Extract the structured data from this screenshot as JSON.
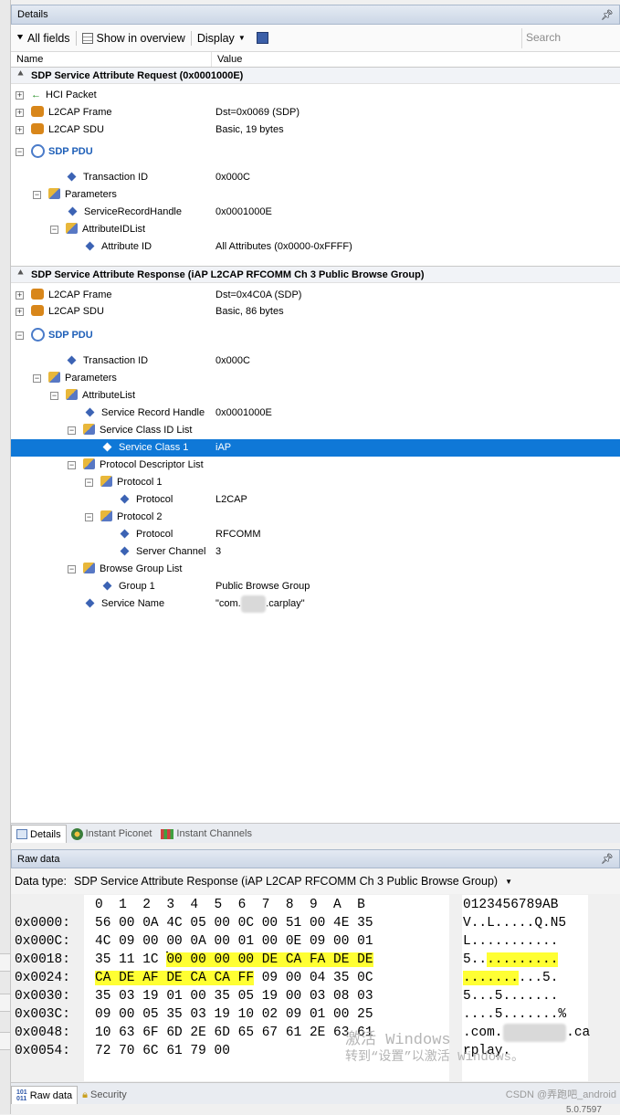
{
  "details_panel": {
    "title": "Details",
    "pin_glyph": "ⅅ",
    "toolbar": {
      "all_fields": "All fields",
      "show_in_overview": "Show in overview",
      "display": "Display",
      "search_placeholder": "Search"
    },
    "columns": {
      "name": "Name",
      "value": "Value"
    }
  },
  "request": {
    "header": "SDP Service Attribute Request (0x0001000E)",
    "rows": [
      {
        "name": "HCI Packet",
        "value": ""
      },
      {
        "name": "L2CAP Frame",
        "value": "Dst=0x0069 (SDP)"
      },
      {
        "name": "L2CAP SDU",
        "value": "Basic, 19 bytes"
      },
      {
        "name": "SDP PDU",
        "value": ""
      },
      {
        "name": "Transaction ID",
        "value": "0x000C"
      },
      {
        "name": "Parameters",
        "value": ""
      },
      {
        "name": "ServiceRecordHandle",
        "value": "0x0001000E"
      },
      {
        "name": "AttributeIDList",
        "value": ""
      },
      {
        "name": "Attribute ID",
        "value": "All Attributes (0x0000-0xFFFF)"
      }
    ]
  },
  "response": {
    "header": "SDP Service Attribute Response (iAP L2CAP RFCOMM Ch 3 Public Browse Group)",
    "rows": [
      {
        "name": "L2CAP Frame",
        "value": "Dst=0x4C0A (SDP)"
      },
      {
        "name": "L2CAP SDU",
        "value": "Basic, 86 bytes"
      },
      {
        "name": "SDP PDU",
        "value": ""
      },
      {
        "name": "Transaction ID",
        "value": "0x000C"
      },
      {
        "name": "Parameters",
        "value": ""
      },
      {
        "name": "AttributeList",
        "value": ""
      },
      {
        "name": "Service Record Handle",
        "value": "0x0001000E"
      },
      {
        "name": "Service Class ID List",
        "value": ""
      },
      {
        "name": "Service Class 1",
        "value": "iAP"
      },
      {
        "name": "Protocol Descriptor List",
        "value": ""
      },
      {
        "name": "Protocol 1",
        "value": ""
      },
      {
        "name": "Protocol",
        "value": "L2CAP"
      },
      {
        "name": "Protocol 2",
        "value": ""
      },
      {
        "name": "Protocol",
        "value": "RFCOMM"
      },
      {
        "name": "Server Channel",
        "value": "3"
      },
      {
        "name": "Browse Group List",
        "value": ""
      },
      {
        "name": "Group 1",
        "value": "Public Browse Group"
      },
      {
        "name": "Service Name",
        "value_prefix": "\"com.",
        "value_suffix": ".carplay\""
      }
    ]
  },
  "bottom_tabs": [
    "Details",
    "Instant Piconet",
    "Instant Channels"
  ],
  "raw_panel": {
    "title": "Raw data",
    "data_type_label": "Data type:",
    "data_type_value": "SDP Service Attribute Response (iAP L2CAP RFCOMM Ch 3 Public Browse Group)",
    "column_header": "0  1  2  3  4  5  6  7  8  9  A  B",
    "ascii_header": "0123456789AB",
    "offsets": [
      "0x0000:",
      "0x000C:",
      "0x0018:",
      "0x0024:",
      "0x0030:",
      "0x003C:",
      "0x0048:",
      "0x0054:"
    ],
    "hex_rows": [
      "56 00 0A 4C 05 00 0C 00 51 00 4E 35",
      "4C 09 00 00 0A 00 01 00 0E 09 00 01",
      "35 11 1C 00 00 00 00 DE CA FA DE DE",
      "CA DE AF DE CA CA FF 09 00 04 35 0C",
      "35 03 19 01 00 35 05 19 00 03 08 03",
      "09 00 05 35 03 19 10 02 09 01 00 25",
      "10 63 6F 6D 2E 6D 65 67 61 2E 63 61",
      "72 70 6C 61 79 00"
    ],
    "ascii_rows": [
      "V..L.....Q.N5",
      "L...........",
      "5...........",
      "..........5.",
      "5...5.......",
      "....5.......%",
      ".com.        .ca",
      "rplay."
    ]
  },
  "raw_tabs": [
    "Raw data",
    "Security"
  ],
  "watermark": {
    "line1": "激活 Windows",
    "line2": "转到“设置”以激活 Windows。",
    "credit": "CSDN @弄跑吧_android",
    "version": "5.0.7597"
  },
  "colors": {
    "selection": "#0f78d7",
    "highlight": "#ffff33",
    "pdu_text": "#1e5fb8"
  }
}
